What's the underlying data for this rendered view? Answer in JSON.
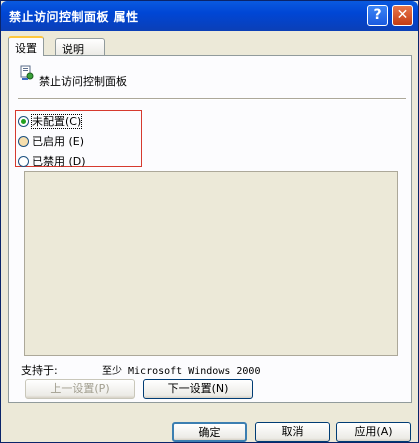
{
  "window": {
    "title": "禁止访问控制面板 属性"
  },
  "titlebar": {
    "help_label": "?",
    "close_label": "✕"
  },
  "tabs": [
    {
      "label": "设置"
    },
    {
      "label": "说明"
    }
  ],
  "policy": {
    "name": "禁止访问控制面板",
    "icon": "policy-icon"
  },
  "options": [
    {
      "label": "未配置",
      "hotkey": "(C)",
      "selected": true
    },
    {
      "label": "已启用",
      "hotkey": "(E)",
      "selected": false
    },
    {
      "label": "已禁用",
      "hotkey": "(D)",
      "selected": false
    }
  ],
  "supported": {
    "label": "支持于:",
    "value": "至少 Microsoft Windows 2000"
  },
  "nav": {
    "prev_label": "上一设置(P)",
    "next_label": "下一设置(N)"
  },
  "footer": {
    "ok_label": "确定",
    "cancel_label": "取消",
    "apply_label": "应用(A)"
  },
  "colors": {
    "title_bar": "#0046d5",
    "highlight_box": "#d63a2e",
    "radio_selected": "#21a121"
  }
}
